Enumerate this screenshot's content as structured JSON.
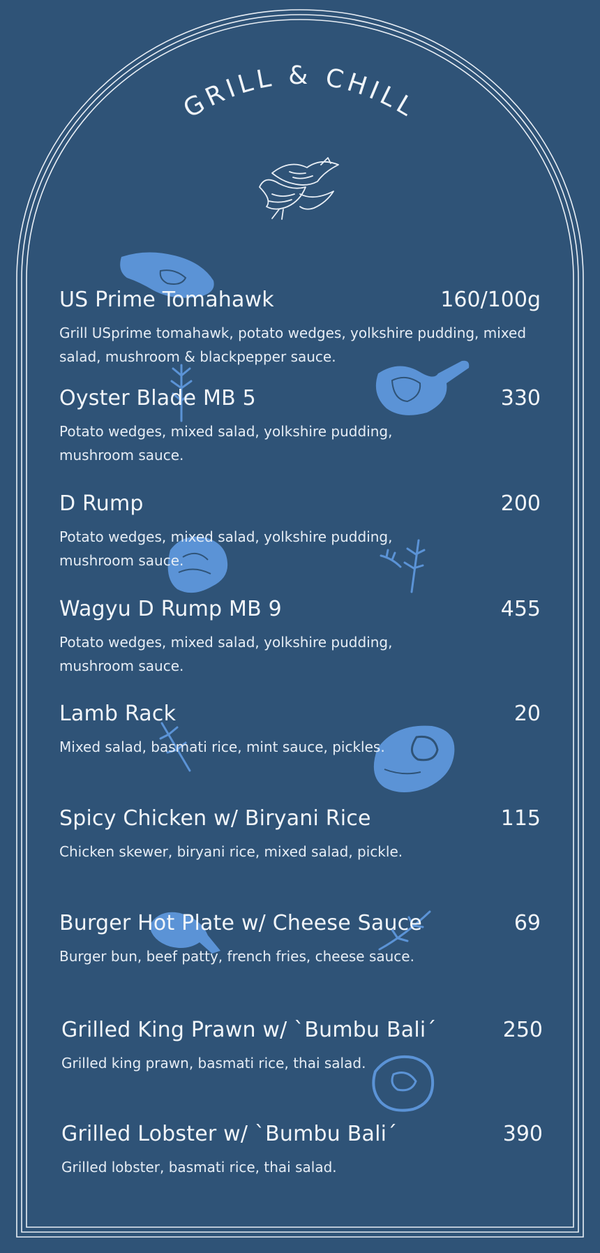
{
  "menu": {
    "title": "GRILL & CHILL",
    "items": [
      {
        "name": "US Prime Tomahawk",
        "price": "160/100g",
        "description": "Grill USprime tomahawk, potato wedges, yolkshire pudding, mixed salad, mushroom & blackpepper sauce."
      },
      {
        "name": "Oyster Blade MB 5",
        "price": "330",
        "description": "Potato wedges, mixed salad, yolkshire pudding, mushroom sauce."
      },
      {
        "name": "D Rump",
        "price": "200",
        "description": "Potato wedges, mixed salad, yolkshire pudding, mushroom sauce."
      },
      {
        "name": "Wagyu D Rump MB 9",
        "price": "455",
        "description": "Potato wedges, mixed salad, yolkshire pudding, mushroom sauce."
      },
      {
        "name": "Lamb Rack",
        "price": "20",
        "description": "Mixed salad, basmati rice, mint sauce, pickles."
      },
      {
        "name": "Spicy Chicken w/ Biryani Rice",
        "price": "115",
        "description": "Chicken skewer, biryani rice, mixed salad, pickle."
      },
      {
        "name": "Burger Hot Plate w/ Cheese Sauce",
        "price": "69",
        "description": "Burger bun, beef patty, french fries, cheese sauce."
      },
      {
        "name": "Grilled King Prawn w/ `Bumbu Bali´",
        "price": "250",
        "description": "Grilled king prawn, basmati rice, thai salad."
      },
      {
        "name": "Grilled Lobster w/ `Bumbu Bali´",
        "price": "390",
        "description": "Grilled lobster, basmati rice, thai salad."
      }
    ]
  },
  "colors": {
    "background": "#2f5377",
    "frame": "#e8eef5",
    "illustration": "#5b93d6",
    "text": "#f1f5f9"
  },
  "icons": [
    "birds-icon",
    "meat-icon",
    "rosemary-icon"
  ]
}
